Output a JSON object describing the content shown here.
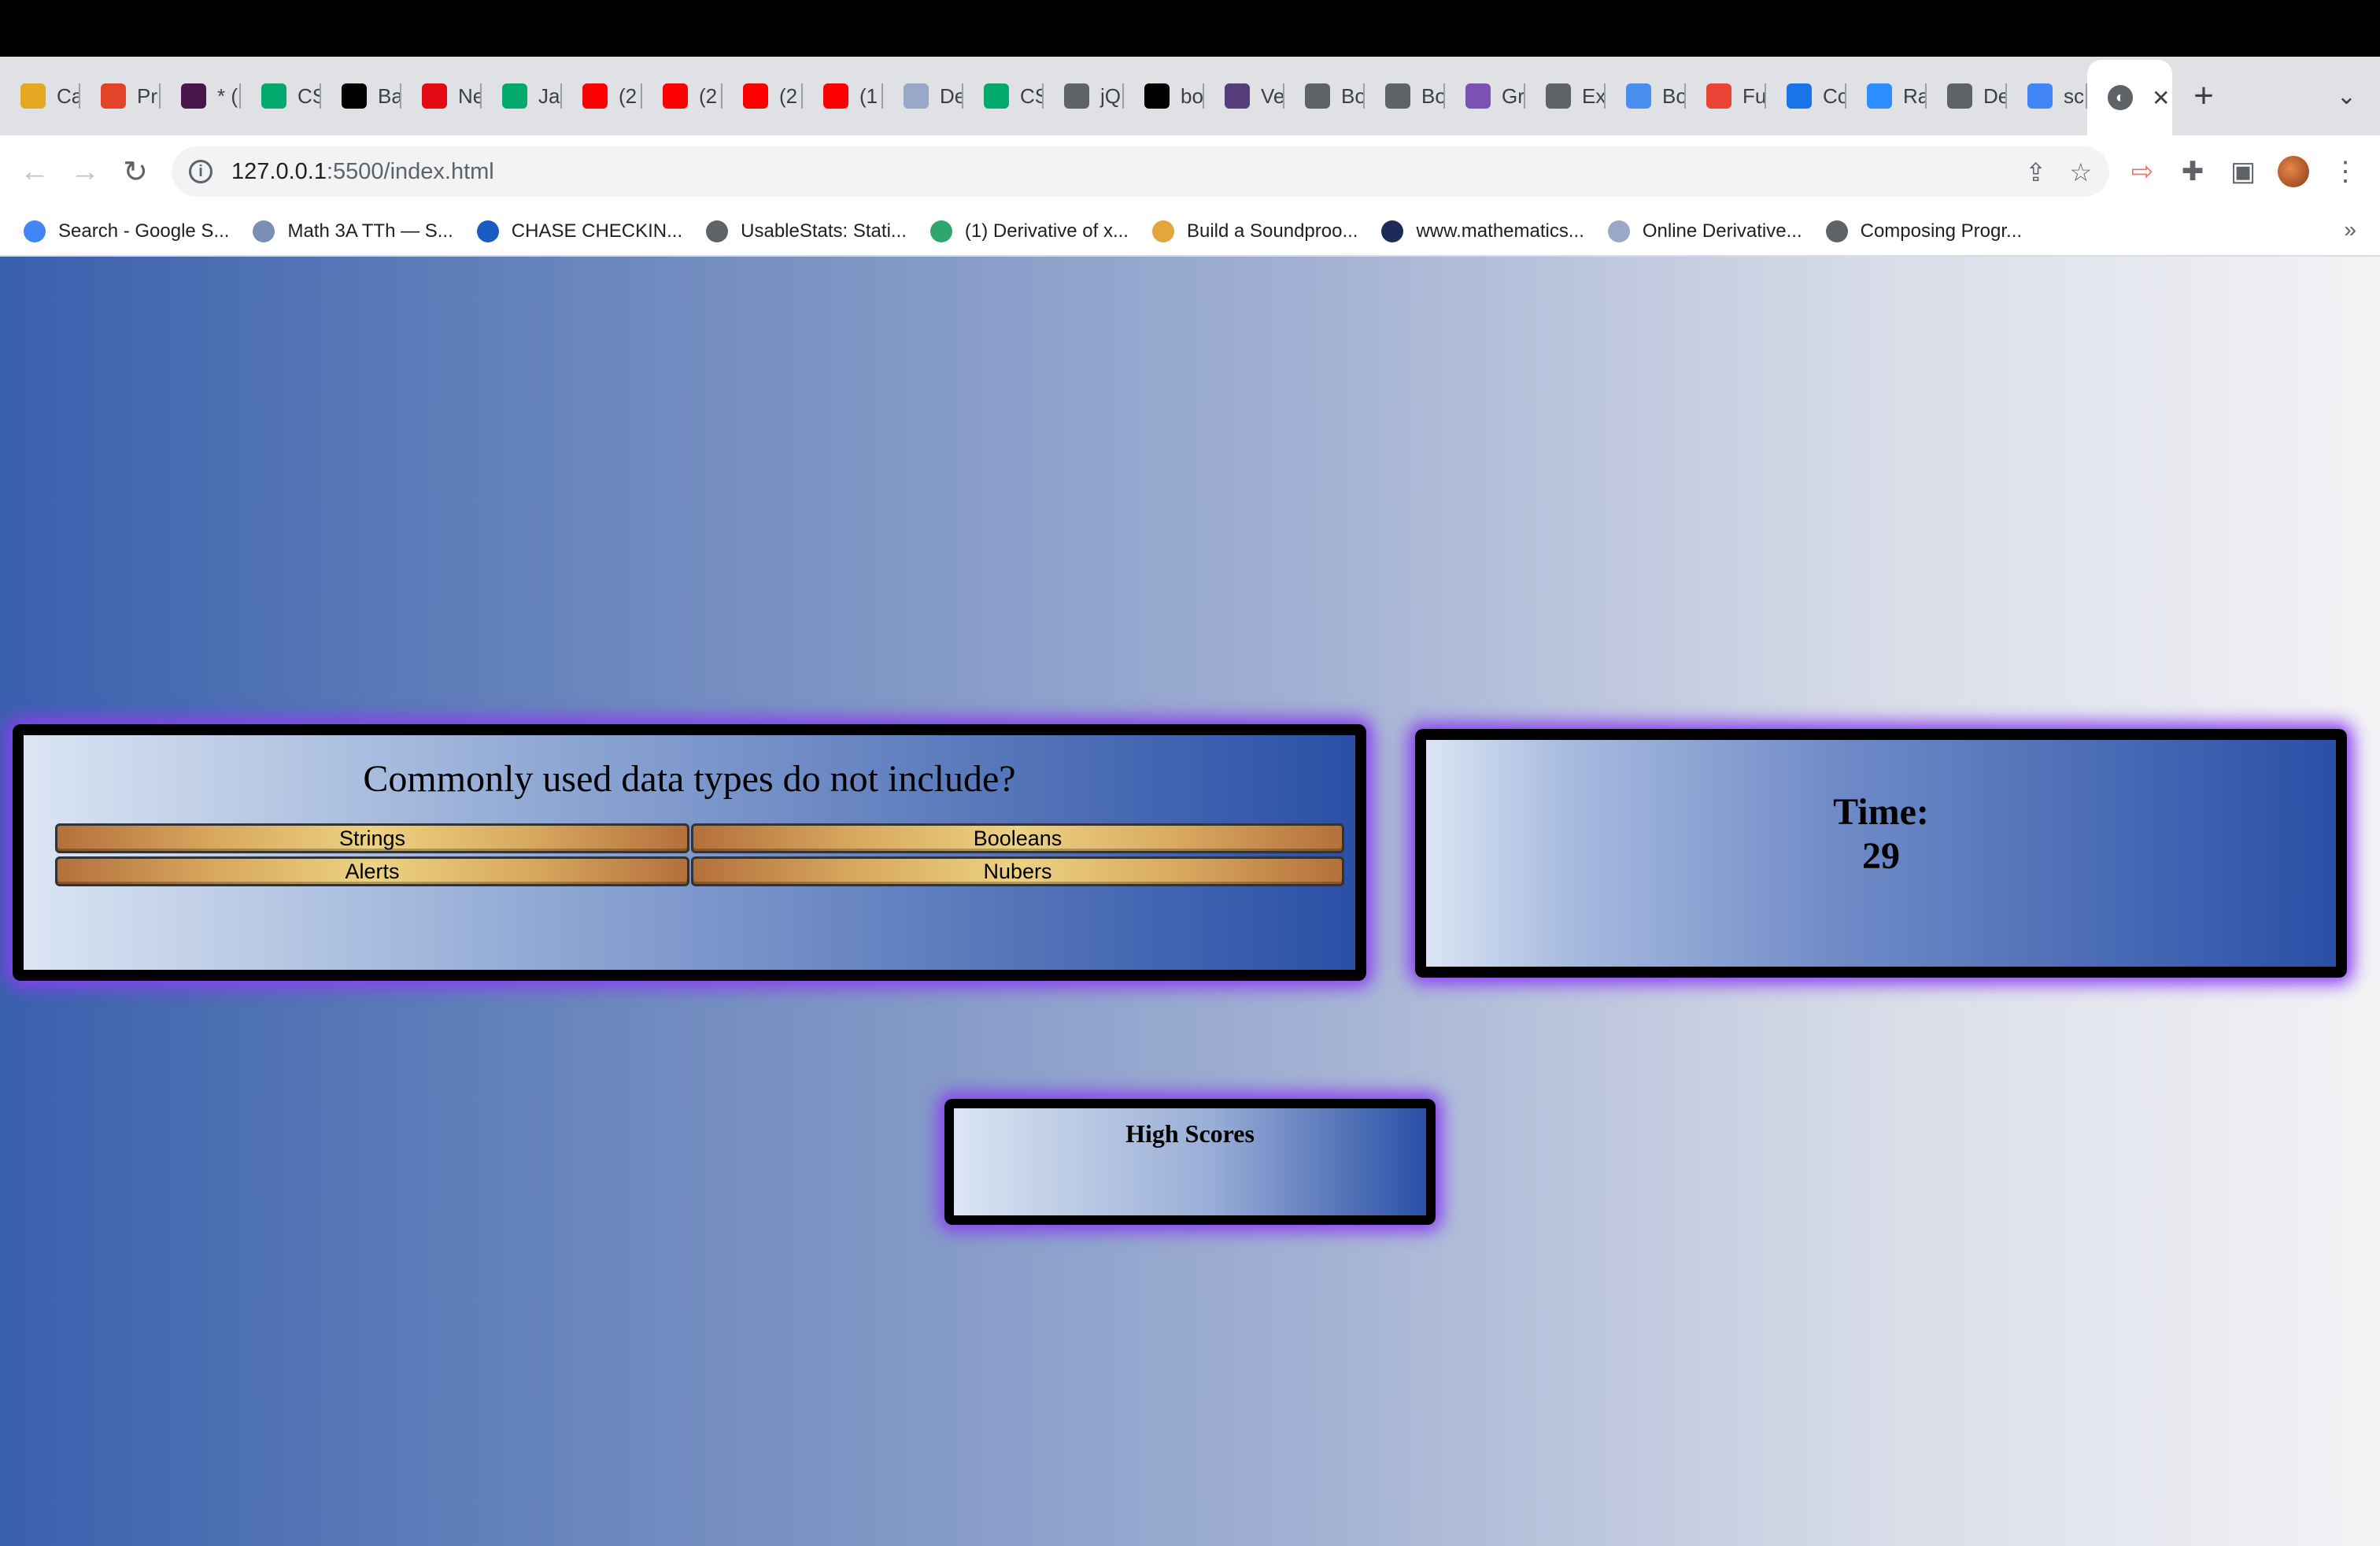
{
  "browser": {
    "tabs": [
      {
        "label": "Ca",
        "icon": "canvas-icon",
        "color": "#e5a823"
      },
      {
        "label": "Pr",
        "icon": "gitlab-icon",
        "color": "#e24329"
      },
      {
        "label": "* (",
        "icon": "slack-icon",
        "color": "#4a154b"
      },
      {
        "label": "CS",
        "icon": "w3schools-icon",
        "color": "#04aa6d"
      },
      {
        "label": "Ba",
        "icon": "medium-icon",
        "color": "#000000"
      },
      {
        "label": "Ne",
        "icon": "netflix-icon",
        "color": "#e50914"
      },
      {
        "label": "Ja",
        "icon": "w3schools-icon",
        "color": "#04aa6d"
      },
      {
        "label": "(2",
        "icon": "youtube-icon",
        "color": "#ff0000"
      },
      {
        "label": "(2",
        "icon": "youtube-icon",
        "color": "#ff0000"
      },
      {
        "label": "(2",
        "icon": "youtube-icon",
        "color": "#ff0000"
      },
      {
        "label": "(1",
        "icon": "youtube-icon",
        "color": "#ff0000"
      },
      {
        "label": "De",
        "icon": "symbolab-icon",
        "color": "#9aa8c8"
      },
      {
        "label": "CS",
        "icon": "w3schools-icon",
        "color": "#04aa6d"
      },
      {
        "label": "jQ",
        "icon": "globe-icon",
        "color": "#5f6368"
      },
      {
        "label": "bo",
        "icon": "medium-icon",
        "color": "#000000"
      },
      {
        "label": "Ve",
        "icon": "bootstrap-icon",
        "color": "#563d7c"
      },
      {
        "label": "Bo",
        "icon": "globe-icon",
        "color": "#5f6368"
      },
      {
        "label": "Bo",
        "icon": "globe-icon",
        "color": "#5f6368"
      },
      {
        "label": "Gr",
        "icon": "bootstrap-icon",
        "color": "#7952b3"
      },
      {
        "label": "Ex",
        "icon": "globe-icon",
        "color": "#5f6368"
      },
      {
        "label": "Bo",
        "icon": "mdn-icon",
        "color": "#4a8ef0"
      },
      {
        "label": "Fu",
        "icon": "gmail-icon",
        "color": "#ea4335"
      },
      {
        "label": "Co",
        "icon": "chrome-ring-icon",
        "color": "#1a73e8"
      },
      {
        "label": "Ra",
        "icon": "zoom-icon",
        "color": "#2d8cff"
      },
      {
        "label": "De",
        "icon": "globe-icon",
        "color": "#5f6368"
      },
      {
        "label": "sc",
        "icon": "google-icon",
        "color": "#4285f4"
      }
    ],
    "active_tab_icon": "globe-icon",
    "url_host": "127.0.0.1",
    "url_path": ":5500/index.html",
    "bookmarks": [
      {
        "label": "Search - Google S...",
        "icon": "google-icon",
        "color": "#4285f4"
      },
      {
        "label": "Math 3A TTh — S...",
        "icon": "gear-icon",
        "color": "#7a8fb5"
      },
      {
        "label": "CHASE CHECKIN...",
        "icon": "chase-icon",
        "color": "#1a5bc4"
      },
      {
        "label": "UsableStats: Stati...",
        "icon": "globe-icon",
        "color": "#5f6368"
      },
      {
        "label": "(1) Derivative of x...",
        "icon": "hex-icon",
        "color": "#2fa66c"
      },
      {
        "label": "Build a Soundproo...",
        "icon": "person-icon",
        "color": "#e4a53a"
      },
      {
        "label": "www.mathematics...",
        "icon": "shield-icon",
        "color": "#1c2b59"
      },
      {
        "label": "Online Derivative...",
        "icon": "symbolab-icon",
        "color": "#9aa8c8"
      },
      {
        "label": "Composing Progr...",
        "icon": "globe-icon",
        "color": "#5f6368"
      }
    ]
  },
  "quiz": {
    "question": "Commonly used data types do not include?",
    "answers": [
      "Strings",
      "Booleans",
      "Alerts",
      "Nubers"
    ]
  },
  "timer": {
    "label": "Time:",
    "value": "29"
  },
  "scores": {
    "title": "High Scores"
  }
}
